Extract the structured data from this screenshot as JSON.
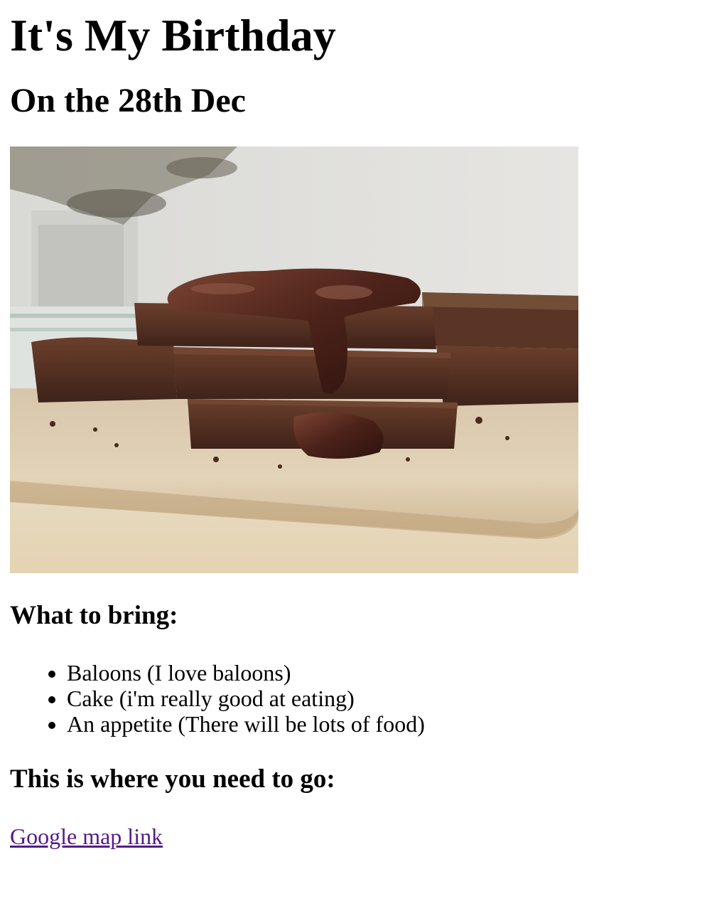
{
  "header": {
    "title": "It's My Birthday",
    "subtitle": "On the 28th Dec"
  },
  "photo": {
    "subject": "chocolate-brownies-icon"
  },
  "bring": {
    "heading": "What to bring:",
    "items": [
      "Baloons (I love baloons)",
      "Cake (i'm really good at eating)",
      "An appetite (There will be lots of food)"
    ]
  },
  "location": {
    "heading": "This is where you need to go:",
    "link_label": "Google map link"
  },
  "colors": {
    "visited_link": "#551a8b",
    "text": "#000000",
    "background": "#ffffff"
  }
}
